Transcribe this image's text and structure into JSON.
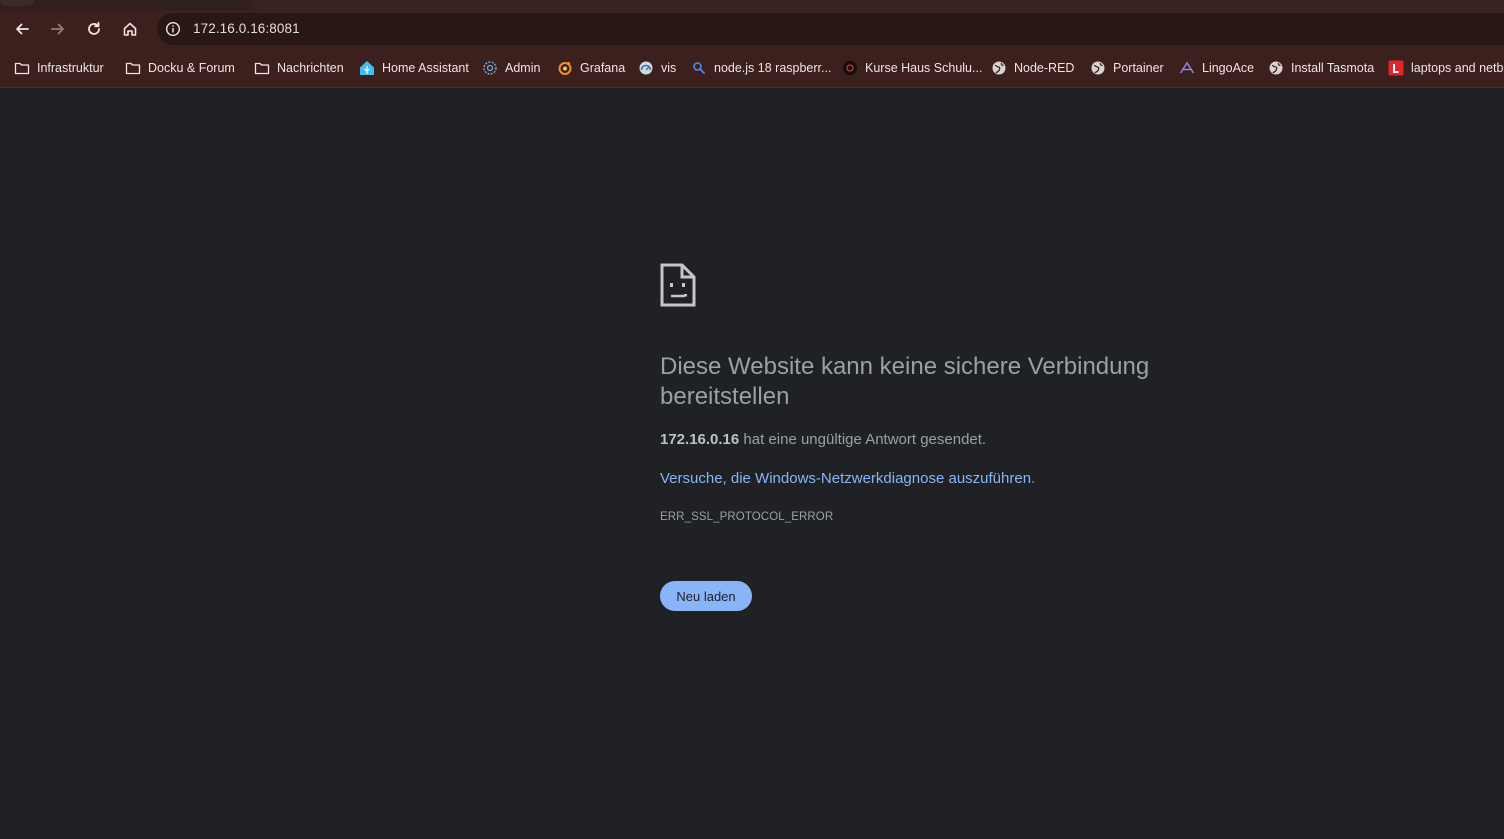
{
  "browser": {
    "url": "172.16.0.16:8081",
    "bookmarks": [
      {
        "label": "Infrastruktur",
        "icon": "folder-icon"
      },
      {
        "label": "Docku & Forum",
        "icon": "folder-icon"
      },
      {
        "label": "Nachrichten",
        "icon": "folder-icon"
      },
      {
        "label": "Home Assistant",
        "icon": "home-assistant-icon"
      },
      {
        "label": "Admin",
        "icon": "gear-icon"
      },
      {
        "label": "Grafana",
        "icon": "grafana-icon"
      },
      {
        "label": "vis",
        "icon": "gauge-icon"
      },
      {
        "label": "node.js 18 raspberr...",
        "icon": "search-icon"
      },
      {
        "label": "Kurse Haus Schulu...",
        "icon": "circle-logo-icon"
      },
      {
        "label": "Node-RED",
        "icon": "globe-icon"
      },
      {
        "label": "Portainer",
        "icon": "globe-icon"
      },
      {
        "label": "LingoAce",
        "icon": "lingoace-icon"
      },
      {
        "label": "Install Tasmota",
        "icon": "globe-icon"
      },
      {
        "label": "laptops and netbo",
        "icon": "letter-l-icon"
      }
    ]
  },
  "error_page": {
    "title": "Diese Website kann keine sichere Verbindung bereitstellen",
    "host": "172.16.0.16",
    "message": " hat eine ungültige Antwort gesendet.",
    "link_text": "Versuche, die Windows-Netzwerkdiagnose auszuführen",
    "link_suffix": ".",
    "error_code": "ERR_SSL_PROTOCOL_ERROR",
    "reload_label": "Neu laden",
    "icon": "sad-page-icon"
  },
  "colors": {
    "background": "#202124",
    "toolbar": "#3b201e",
    "accent": "#8ab4f8",
    "text": "#9aa0a6"
  }
}
